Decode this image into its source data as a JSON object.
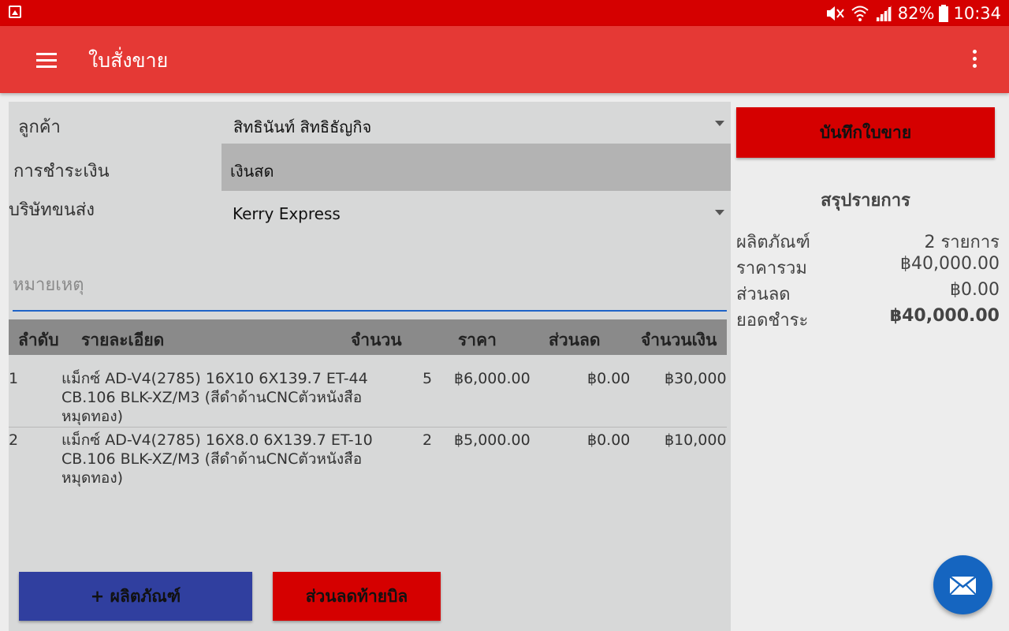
{
  "status_bar": {
    "battery": "82%",
    "time": "10:34"
  },
  "app_bar": {
    "title": "ใบสั่งขาย"
  },
  "form": {
    "customer_label": "ลูกค้า",
    "customer_value": "สิทธินันท์ สิทธิธัญกิจ",
    "payment_label": "การชำระเงิน",
    "payment_value": "เงินสด",
    "shipping_label": "บริษัทขนส่ง",
    "shipping_value": "Kerry Express",
    "note_placeholder": "หมายเหตุ"
  },
  "table": {
    "headers": [
      "ลำดับ",
      "รายละเอียด",
      "จำนวน",
      "ราคา",
      "ส่วนลด",
      "จำนวนเงิน"
    ],
    "rows": [
      {
        "no": "1",
        "detail_1": "แม็กซ์ AD-V4(2785) 16X10 6X139.7 ET-44",
        "detail_2": "CB.106 BLK-XZ/M3  (สีดำด้านCNCตัวหนังสือ",
        "detail_3": "หมุดทอง)",
        "qty": "5",
        "price": "฿6,000.00",
        "discount": "฿0.00",
        "amount": "฿30,000.00"
      },
      {
        "no": "2",
        "detail_1": "แม็กซ์ AD-V4(2785) 16X8.0 6X139.7 ET-10",
        "detail_2": "CB.106 BLK-XZ/M3  (สีดำด้านCNCตัวหนังสือ",
        "detail_3": "หมุดทอง)",
        "qty": "2",
        "price": "฿5,000.00",
        "discount": "฿0.00",
        "amount": "฿10,000.00"
      }
    ]
  },
  "buttons": {
    "add_product": "+ ผลิตภัณฑ์",
    "bill_discount": "ส่วนลดท้ายบิล",
    "save": "บันทึกใบขาย"
  },
  "summary": {
    "title": "สรุปรายการ",
    "rows": [
      {
        "label": "ผลิตภัณฑ์",
        "value": "2 รายการ"
      },
      {
        "label": "ราคารวม",
        "value": "฿40,000.00"
      },
      {
        "label": "ส่วนลด",
        "value": "฿0.00"
      },
      {
        "label": "ยอดชำระ",
        "value": "฿40,000.00"
      }
    ]
  },
  "colors": {
    "status_bar": "#d50000",
    "app_bar": "#e53935",
    "primary_red": "#d50000",
    "blue_button": "#303f9f",
    "fab": "#1565c0",
    "input_underline": "#1e63c8"
  },
  "icons": [
    "image-icon",
    "mute-icon",
    "wifi-icon",
    "signal-icon",
    "battery-icon",
    "menu-icon",
    "overflow-menu-icon",
    "dropdown-arrow-icon",
    "mail-icon"
  ]
}
